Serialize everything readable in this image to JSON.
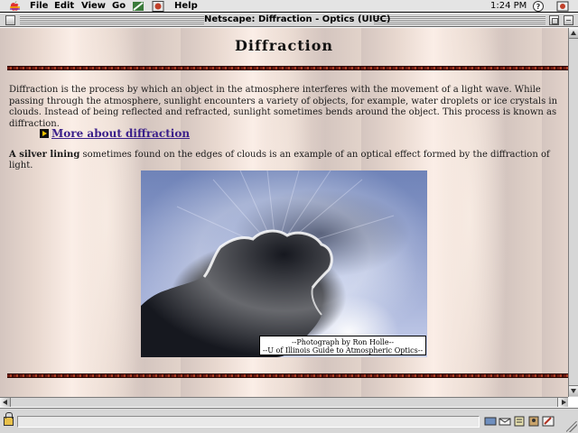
{
  "menubar": {
    "items": [
      "File",
      "Edit",
      "View",
      "Go",
      "Help"
    ],
    "clock": "1:24 PM"
  },
  "window": {
    "title": "Netscape: Diffraction - Optics (UIUC)"
  },
  "page": {
    "heading": "Diffraction",
    "intro": "Diffraction is the process by which an object in the atmosphere interferes with the movement of a light wave. While passing through the atmosphere, sunlight encounters a variety of objects, for example, water droplets or ice crystals in clouds. Instead of being reflected and refracted, sunlight sometimes bends around the object. This process is known as diffraction.",
    "more_link": "More about diffraction",
    "silver_term": "A silver lining",
    "silver_rest": " sometimes found on the edges of clouds is an example of an optical effect formed by the diffraction of light.",
    "caption_line1": "--Photograph by Ron Holle--",
    "caption_line2": "--U of Illinois Guide to Atmospheric Optics--"
  },
  "colors": {
    "link": "#3a1f8a",
    "rule": "#6b1a10",
    "chrome": "#d6d6d6"
  },
  "icons": [
    "apple-icon",
    "app-icon",
    "netscape-icon",
    "help-icon",
    "app-switcher-icon",
    "arrow-bullet-icon",
    "lock-icon",
    "component-bar-icons"
  ]
}
